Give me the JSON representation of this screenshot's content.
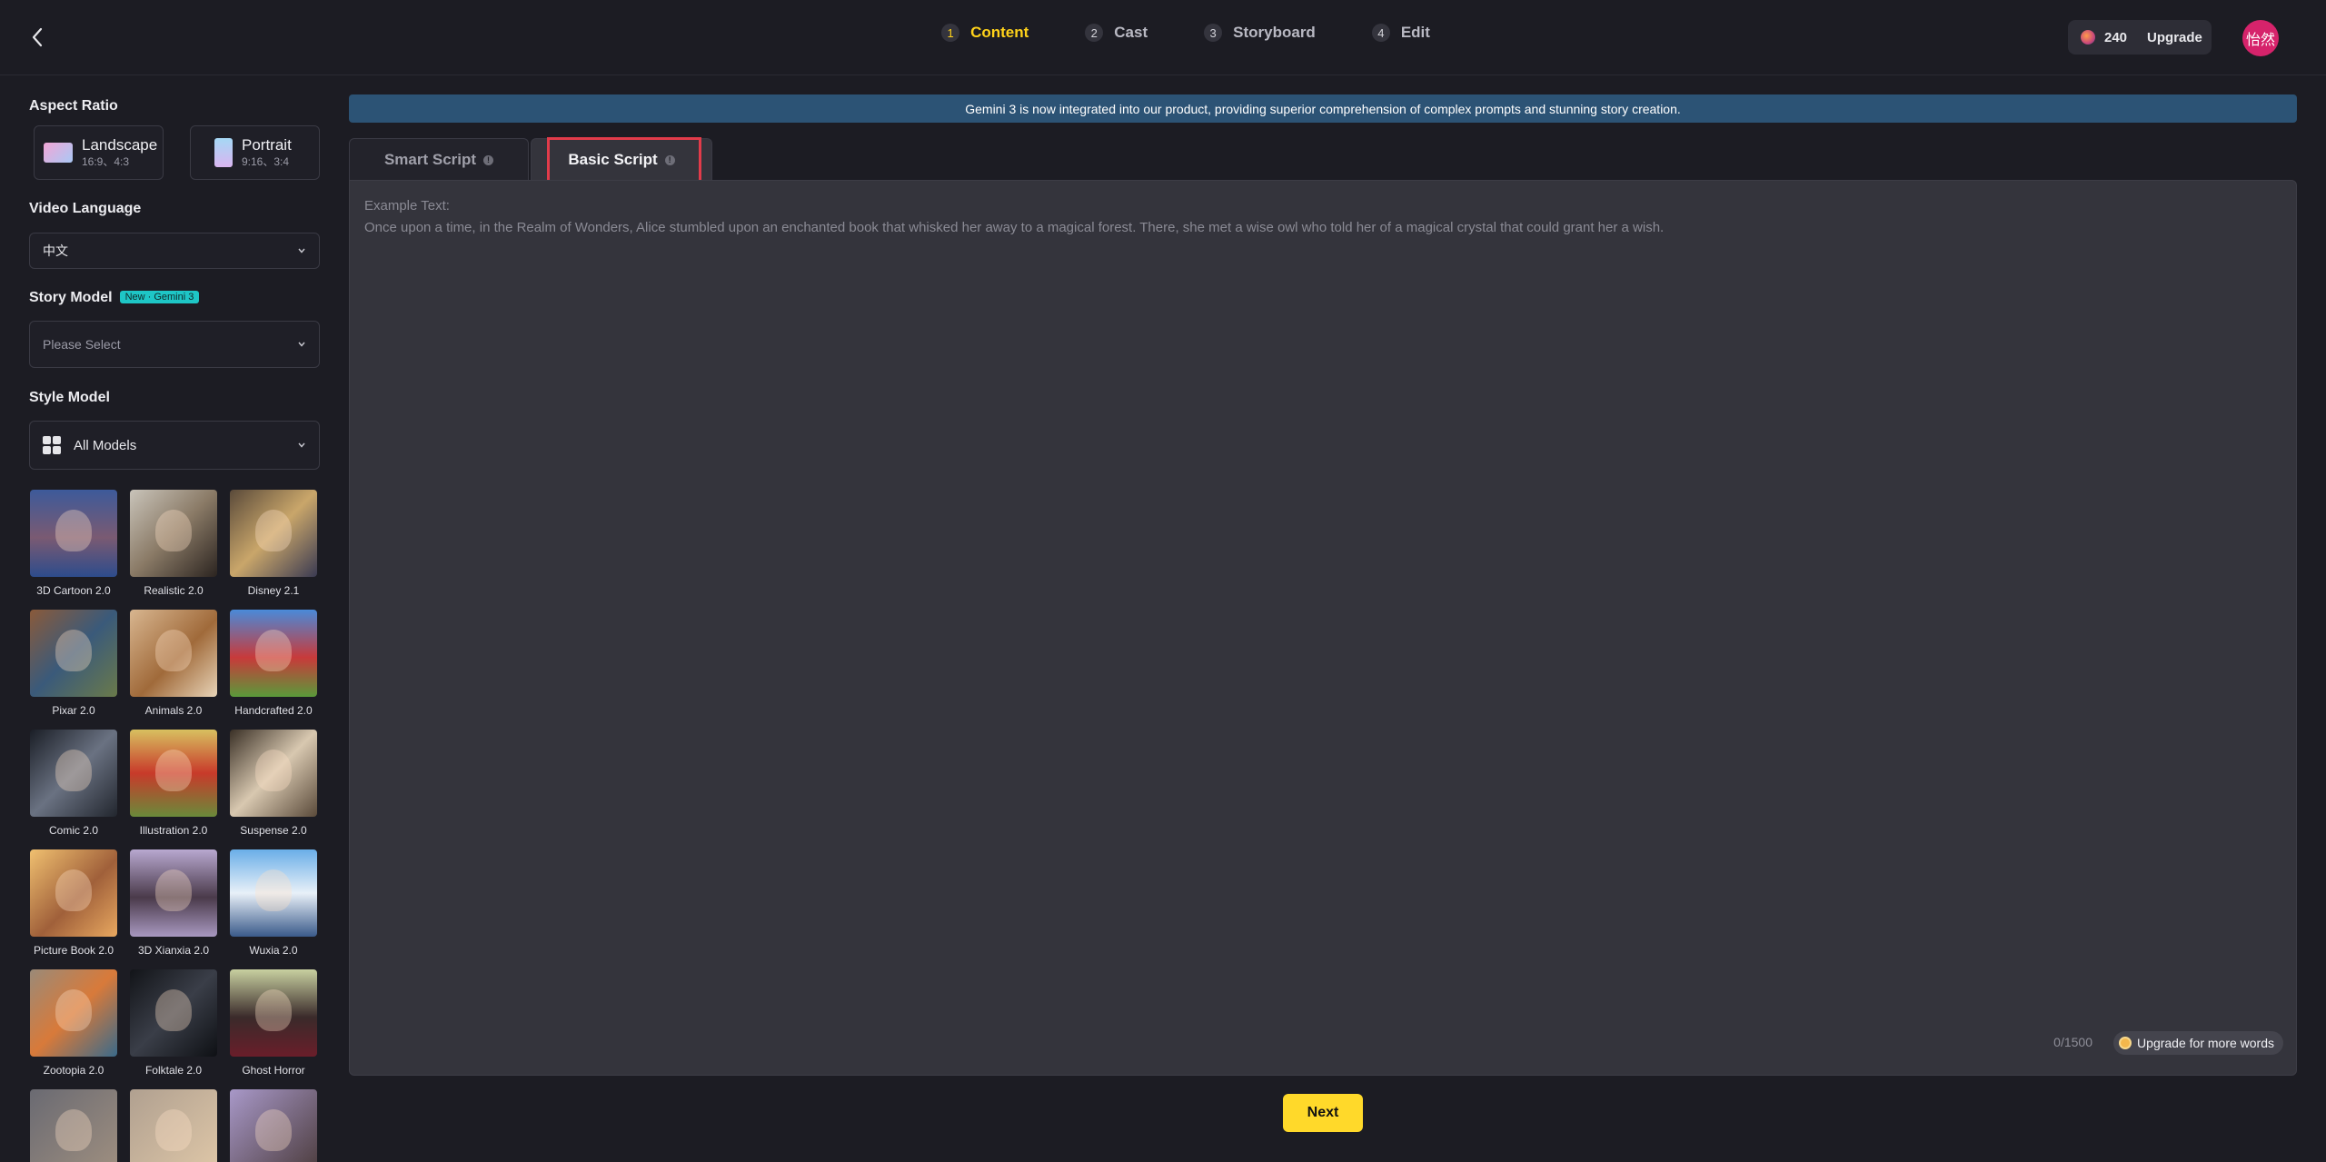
{
  "header": {
    "steps": [
      {
        "num": "1",
        "label": "Content"
      },
      {
        "num": "2",
        "label": "Cast"
      },
      {
        "num": "3",
        "label": "Storyboard"
      },
      {
        "num": "4",
        "label": "Edit"
      }
    ],
    "credits": "240",
    "upgrade_label": "Upgrade",
    "avatar_text": "怡然"
  },
  "sidebar": {
    "aspect_ratio_label": "Aspect Ratio",
    "landscape": {
      "title": "Landscape",
      "ratios": "16:9、4:3"
    },
    "portrait": {
      "title": "Portrait",
      "ratios": "9:16、3:4"
    },
    "video_language_label": "Video Language",
    "video_language_value": "中文",
    "story_model_label": "Story Model",
    "story_model_badge": "New · Gemini 3",
    "story_model_placeholder": "Please Select",
    "style_model_label": "Style Model",
    "style_model_value": "All Models",
    "models": [
      {
        "name": "3D Cartoon 2.0"
      },
      {
        "name": "Realistic 2.0"
      },
      {
        "name": "Disney 2.1"
      },
      {
        "name": "Pixar 2.0"
      },
      {
        "name": "Animals 2.0"
      },
      {
        "name": "Handcrafted 2.0"
      },
      {
        "name": "Comic 2.0"
      },
      {
        "name": "Illustration 2.0"
      },
      {
        "name": "Suspense 2.0"
      },
      {
        "name": "Picture Book 2.0"
      },
      {
        "name": "3D Xianxia 2.0"
      },
      {
        "name": "Wuxia 2.0"
      },
      {
        "name": "Zootopia 2.0"
      },
      {
        "name": "Folktale 2.0"
      },
      {
        "name": "Ghost Horror"
      },
      {
        "name": ""
      },
      {
        "name": ""
      },
      {
        "name": ""
      }
    ]
  },
  "main": {
    "banner": "Gemini 3 is now integrated into our product, providing superior comprehension of complex prompts and stunning story creation.",
    "tabs": [
      {
        "label": "Smart Script"
      },
      {
        "label": "Basic Script"
      }
    ],
    "placeholder": "Example Text:\nOnce upon a time, in the Realm of Wonders, Alice stumbled upon an enchanted book that whisked her away to a magical forest. There, she met a wise owl who told her of a magical crystal that could grant her a wish.",
    "text_value": "",
    "word_count": "0/1500",
    "upgrade_words_label": "Upgrade for more words",
    "next_label": "Next"
  },
  "colors": {
    "accent_yellow": "#ffd21a",
    "banner_blue": "#2c5375",
    "highlight_red": "#e23b4a",
    "avatar_pink": "#d6236b"
  }
}
